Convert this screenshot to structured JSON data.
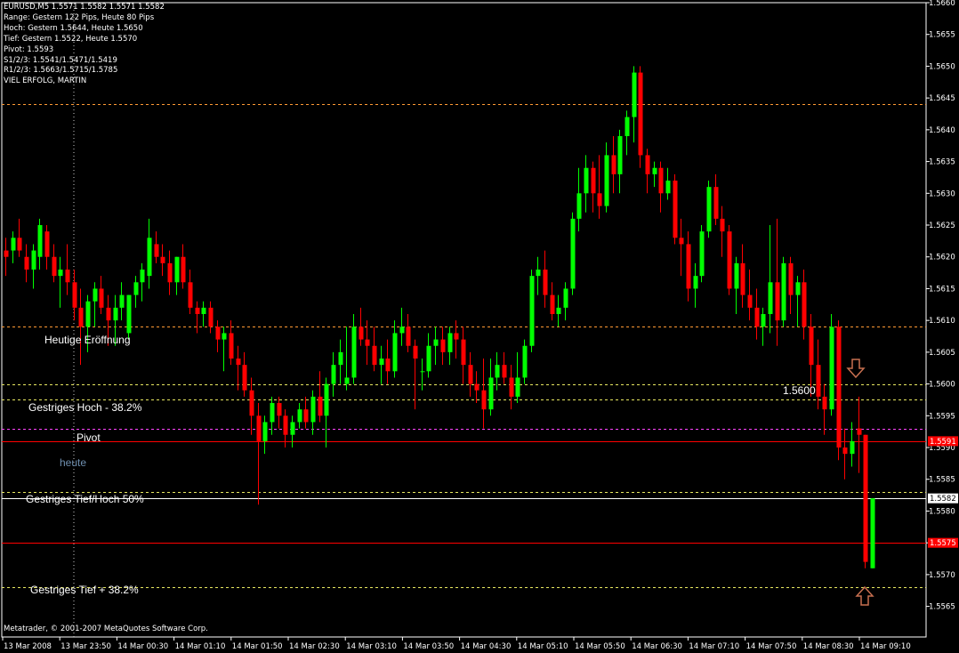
{
  "chart_info": {
    "symbol_line": "EURUSD,M5  1.5571 1.5582 1.5571 1.5582",
    "lines": [
      "Range: Gestern 122 Pips, Heute 80 Pips",
      "Hoch: Gestern 1.5644, Heute 1.5650",
      "Tief:  Gestern 1.5522, Heute 1.5570",
      "Pivot: 1.5593",
      "S1/2/3: 1.5541/1.5471/1.5419",
      "R1/2/3: 1.5663/1.5715/1.5785",
      "VIEL ERFOLG, MARTIN"
    ]
  },
  "footer": "Metatrader, © 2001-2007 MetaQuotes Software Corp.",
  "level_labels": {
    "eroeffnung": "Heutige Eröffnung",
    "hoch382": "Gestriges Hoch - 38.2%",
    "pivot": "Pivot",
    "heute": "heute",
    "tiefhoch50": "Gestriges Tief/Hoch 50%",
    "tief382": "Gestriges Tief + 38.2%",
    "mark1600": "1.5600"
  },
  "colors": {
    "background": "#000000",
    "bull": "#00ff00",
    "bear": "#ff0000",
    "axis": "#ffffff",
    "dotted_grid": "#c8c8c8",
    "orange_level": "#ff9933",
    "yellow_level": "#e8e860",
    "magenta_level": "#ff44ff",
    "arrow": "#c87050"
  },
  "chart_data": {
    "type": "candlestick",
    "ylim": [
      1.5562,
      1.566
    ],
    "y_ticks": [
      "1.5660",
      "1.5655",
      "1.5650",
      "1.5645",
      "1.5640",
      "1.5635",
      "1.5630",
      "1.5625",
      "1.5620",
      "1.5615",
      "1.5610",
      "1.5605",
      "1.5600",
      "1.5595",
      "1.5590",
      "1.5585",
      "1.5580",
      "1.5575",
      "1.5570",
      "1.5565"
    ],
    "x_ticks": [
      "13 Mar 2008",
      "13 Mar 23:50",
      "14 Mar 00:30",
      "14 Mar 01:10",
      "14 Mar 01:50",
      "14 Mar 02:30",
      "14 Mar 03:10",
      "14 Mar 03:50",
      "14 Mar 04:30",
      "14 Mar 05:10",
      "14 Mar 05:50",
      "14 Mar 06:30",
      "14 Mar 07:10",
      "14 Mar 07:50",
      "14 Mar 08:30",
      "14 Mar 09:10"
    ],
    "price_badges": [
      {
        "value": "1.5591",
        "color": "#ff0000",
        "text_color": "#ffffff"
      },
      {
        "value": "1.5582",
        "color": "#ffffff",
        "text_color": "#000000"
      },
      {
        "value": "1.5575",
        "color": "#ff0000",
        "text_color": "#ffffff"
      }
    ],
    "levels": [
      {
        "name": "Gestriges Hoch",
        "value": 1.5644,
        "style": "dotted",
        "color": "#ff9933"
      },
      {
        "name": "Heutige Eröffnung",
        "value": 1.5609,
        "style": "dotted",
        "color": "#ff9933"
      },
      {
        "name": "1.5600",
        "value": 1.56,
        "style": "dotted",
        "color": "#e8e860"
      },
      {
        "name": "Gestriges Hoch - 38.2%",
        "value": 1.55975,
        "style": "dotted",
        "color": "#e8e860"
      },
      {
        "name": "Pivot",
        "value": 1.5593,
        "style": "dotted",
        "color": "#ff44ff"
      },
      {
        "name": "heute",
        "value": 1.5591,
        "style": "solid",
        "color": "#ff0000"
      },
      {
        "name": "Gestriges Tief/Hoch 50%",
        "value": 1.5583,
        "style": "dotted",
        "color": "#e8e860"
      },
      {
        "name": "bid",
        "value": 1.5582,
        "style": "solid",
        "color": "#ffffff"
      },
      {
        "name": "level",
        "value": 1.5575,
        "style": "solid",
        "color": "#ff0000"
      },
      {
        "name": "Gestriges Tief + 38.2%",
        "value": 1.5568,
        "style": "dotted",
        "color": "#e8e860"
      }
    ],
    "candles": [
      [
        1.5621,
        1.5623,
        1.5617,
        1.562
      ],
      [
        1.5621,
        1.5624,
        1.5619,
        1.5623
      ],
      [
        1.5623,
        1.5626,
        1.562,
        1.5621
      ],
      [
        1.562,
        1.5622,
        1.5616,
        1.5618
      ],
      [
        1.5618,
        1.5622,
        1.5615,
        1.5621
      ],
      [
        1.562,
        1.5626,
        1.5618,
        1.5625
      ],
      [
        1.5624,
        1.5625,
        1.5618,
        1.562
      ],
      [
        1.562,
        1.5622,
        1.5616,
        1.5617
      ],
      [
        1.5617,
        1.562,
        1.5612,
        1.5618
      ],
      [
        1.5618,
        1.5622,
        1.5614,
        1.5616
      ],
      [
        1.5616,
        1.5618,
        1.561,
        1.5612
      ],
      [
        1.5612,
        1.5615,
        1.5603,
        1.5609
      ],
      [
        1.5609,
        1.5614,
        1.5605,
        1.5613
      ],
      [
        1.5613,
        1.5616,
        1.5609,
        1.5615
      ],
      [
        1.5615,
        1.5617,
        1.5611,
        1.5612
      ],
      [
        1.5612,
        1.5614,
        1.5606,
        1.561
      ],
      [
        1.561,
        1.5614,
        1.5606,
        1.5612
      ],
      [
        1.5612,
        1.5616,
        1.561,
        1.5614
      ],
      [
        1.5608,
        1.5614,
        1.5607,
        1.5614
      ],
      [
        1.5614,
        1.5617,
        1.5612,
        1.5616
      ],
      [
        1.5616,
        1.5619,
        1.5613,
        1.5618
      ],
      [
        1.5617,
        1.5626,
        1.5615,
        1.5623
      ],
      [
        1.5622,
        1.5624,
        1.5619,
        1.562
      ],
      [
        1.562,
        1.5622,
        1.5617,
        1.5619
      ],
      [
        1.5619,
        1.5621,
        1.5614,
        1.5616
      ],
      [
        1.5616,
        1.562,
        1.5614,
        1.562
      ],
      [
        1.562,
        1.5622,
        1.5615,
        1.5616
      ],
      [
        1.5616,
        1.5618,
        1.5611,
        1.5612
      ],
      [
        1.5612,
        1.5613,
        1.5608,
        1.5611
      ],
      [
        1.5611,
        1.5613,
        1.5609,
        1.5612
      ],
      [
        1.5612,
        1.5613,
        1.5608,
        1.5609
      ],
      [
        1.5609,
        1.561,
        1.5605,
        1.5607
      ],
      [
        1.5607,
        1.5609,
        1.5602,
        1.5608
      ],
      [
        1.5608,
        1.561,
        1.5603,
        1.5604
      ],
      [
        1.5604,
        1.5606,
        1.5599,
        1.5603
      ],
      [
        1.5603,
        1.5605,
        1.5598,
        1.5599
      ],
      [
        1.5599,
        1.5601,
        1.5592,
        1.5595
      ],
      [
        1.5595,
        1.5597,
        1.5581,
        1.5591
      ],
      [
        1.5591,
        1.5595,
        1.5589,
        1.5594
      ],
      [
        1.5594,
        1.5598,
        1.5592,
        1.5597
      ],
      [
        1.5597,
        1.5598,
        1.5593,
        1.5595
      ],
      [
        1.5595,
        1.5596,
        1.559,
        1.5592
      ],
      [
        1.5592,
        1.5595,
        1.559,
        1.5594
      ],
      [
        1.5594,
        1.5597,
        1.5593,
        1.5596
      ],
      [
        1.5596,
        1.5598,
        1.5593,
        1.5594
      ],
      [
        1.5594,
        1.5599,
        1.5592,
        1.5598
      ],
      [
        1.5598,
        1.5602,
        1.5594,
        1.5595
      ],
      [
        1.5595,
        1.5601,
        1.559,
        1.56
      ],
      [
        1.56,
        1.5605,
        1.5598,
        1.5603
      ],
      [
        1.5603,
        1.5607,
        1.56,
        1.5605
      ],
      [
        1.56,
        1.5609,
        1.5599,
        1.5601
      ],
      [
        1.5601,
        1.5611,
        1.56,
        1.5609
      ],
      [
        1.5609,
        1.5612,
        1.5606,
        1.5607
      ],
      [
        1.5607,
        1.561,
        1.5603,
        1.5606
      ],
      [
        1.5606,
        1.5609,
        1.5602,
        1.5603
      ],
      [
        1.5603,
        1.5606,
        1.56,
        1.5604
      ],
      [
        1.5604,
        1.5607,
        1.56,
        1.5602
      ],
      [
        1.5602,
        1.561,
        1.5601,
        1.5608
      ],
      [
        1.5608,
        1.5612,
        1.5606,
        1.5609
      ],
      [
        1.5609,
        1.5611,
        1.5605,
        1.5606
      ],
      [
        1.5606,
        1.5607,
        1.5596,
        1.5604
      ],
      [
        1.5602,
        1.5604,
        1.5599,
        1.5602
      ],
      [
        1.5602,
        1.5608,
        1.5601,
        1.5606
      ],
      [
        1.5606,
        1.5609,
        1.5603,
        1.5607
      ],
      [
        1.5607,
        1.5609,
        1.5603,
        1.5605
      ],
      [
        1.5605,
        1.5609,
        1.5603,
        1.5608
      ],
      [
        1.5608,
        1.561,
        1.5604,
        1.5607
      ],
      [
        1.5607,
        1.5609,
        1.56,
        1.5603
      ],
      [
        1.5603,
        1.5605,
        1.5598,
        1.56
      ],
      [
        1.56,
        1.5602,
        1.5597,
        1.5599
      ],
      [
        1.5599,
        1.5604,
        1.5593,
        1.5596
      ],
      [
        1.5596,
        1.5604,
        1.5595,
        1.5601
      ],
      [
        1.5601,
        1.5605,
        1.5599,
        1.5603
      ],
      [
        1.5603,
        1.5605,
        1.56,
        1.5601
      ],
      [
        1.5601,
        1.5603,
        1.5596,
        1.5598
      ],
      [
        1.5598,
        1.5605,
        1.5597,
        1.5601
      ],
      [
        1.5601,
        1.5607,
        1.56,
        1.5606
      ],
      [
        1.5606,
        1.5618,
        1.5605,
        1.5617
      ],
      [
        1.5617,
        1.562,
        1.5614,
        1.5618
      ],
      [
        1.5618,
        1.5621,
        1.5612,
        1.5614
      ],
      [
        1.5614,
        1.5616,
        1.561,
        1.5611
      ],
      [
        1.5611,
        1.5614,
        1.5609,
        1.5612
      ],
      [
        1.5612,
        1.5616,
        1.561,
        1.5615
      ],
      [
        1.5615,
        1.5627,
        1.5614,
        1.5626
      ],
      [
        1.5626,
        1.5634,
        1.5624,
        1.563
      ],
      [
        1.563,
        1.5636,
        1.5627,
        1.5634
      ],
      [
        1.5634,
        1.5635,
        1.5627,
        1.563
      ],
      [
        1.563,
        1.5636,
        1.5626,
        1.5628
      ],
      [
        1.5628,
        1.5638,
        1.5627,
        1.5636
      ],
      [
        1.5636,
        1.5639,
        1.563,
        1.5633
      ],
      [
        1.5633,
        1.564,
        1.563,
        1.5639
      ],
      [
        1.5639,
        1.5643,
        1.5636,
        1.5642
      ],
      [
        1.5642,
        1.565,
        1.5638,
        1.5649
      ],
      [
        1.5649,
        1.565,
        1.5634,
        1.5636
      ],
      [
        1.5636,
        1.5637,
        1.563,
        1.5633
      ],
      [
        1.5633,
        1.5635,
        1.5631,
        1.5634
      ],
      [
        1.5634,
        1.5635,
        1.5627,
        1.563
      ],
      [
        1.563,
        1.5634,
        1.5629,
        1.5632
      ],
      [
        1.5632,
        1.5633,
        1.5622,
        1.5623
      ],
      [
        1.5623,
        1.5626,
        1.5617,
        1.5622
      ],
      [
        1.5622,
        1.5624,
        1.5613,
        1.5615
      ],
      [
        1.5615,
        1.5619,
        1.5612,
        1.5617
      ],
      [
        1.5617,
        1.5625,
        1.5616,
        1.5624
      ],
      [
        1.5624,
        1.5632,
        1.5623,
        1.5631
      ],
      [
        1.5631,
        1.5633,
        1.5625,
        1.5626
      ],
      [
        1.5626,
        1.5628,
        1.562,
        1.5624
      ],
      [
        1.5624,
        1.5625,
        1.5614,
        1.5615
      ],
      [
        1.5615,
        1.562,
        1.5611,
        1.5619
      ],
      [
        1.5619,
        1.5622,
        1.5612,
        1.5614
      ],
      [
        1.5614,
        1.5618,
        1.561,
        1.5612
      ],
      [
        1.5612,
        1.5615,
        1.5607,
        1.5609
      ],
      [
        1.5609,
        1.5612,
        1.5606,
        1.5611
      ],
      [
        1.5611,
        1.5625,
        1.5608,
        1.5616
      ],
      [
        1.5616,
        1.5626,
        1.5606,
        1.561
      ],
      [
        1.561,
        1.562,
        1.5609,
        1.5619
      ],
      [
        1.5619,
        1.562,
        1.5611,
        1.5614
      ],
      [
        1.5614,
        1.5617,
        1.5609,
        1.5616
      ],
      [
        1.5616,
        1.5618,
        1.5607,
        1.5609
      ],
      [
        1.5609,
        1.5611,
        1.5598,
        1.5603
      ],
      [
        1.5603,
        1.5607,
        1.5596,
        1.5598
      ],
      [
        1.5598,
        1.56,
        1.5592,
        1.5596
      ],
      [
        1.5596,
        1.5611,
        1.5595,
        1.5609
      ],
      [
        1.5609,
        1.561,
        1.5588,
        1.559
      ],
      [
        1.559,
        1.5593,
        1.5585,
        1.5589
      ],
      [
        1.5589,
        1.5594,
        1.5587,
        1.5591
      ],
      [
        1.5593,
        1.5598,
        1.5586,
        1.5592
      ],
      [
        1.5592,
        1.5592,
        1.5571,
        1.5572
      ],
      [
        1.5571,
        1.5582,
        1.5571,
        1.5582
      ]
    ]
  }
}
